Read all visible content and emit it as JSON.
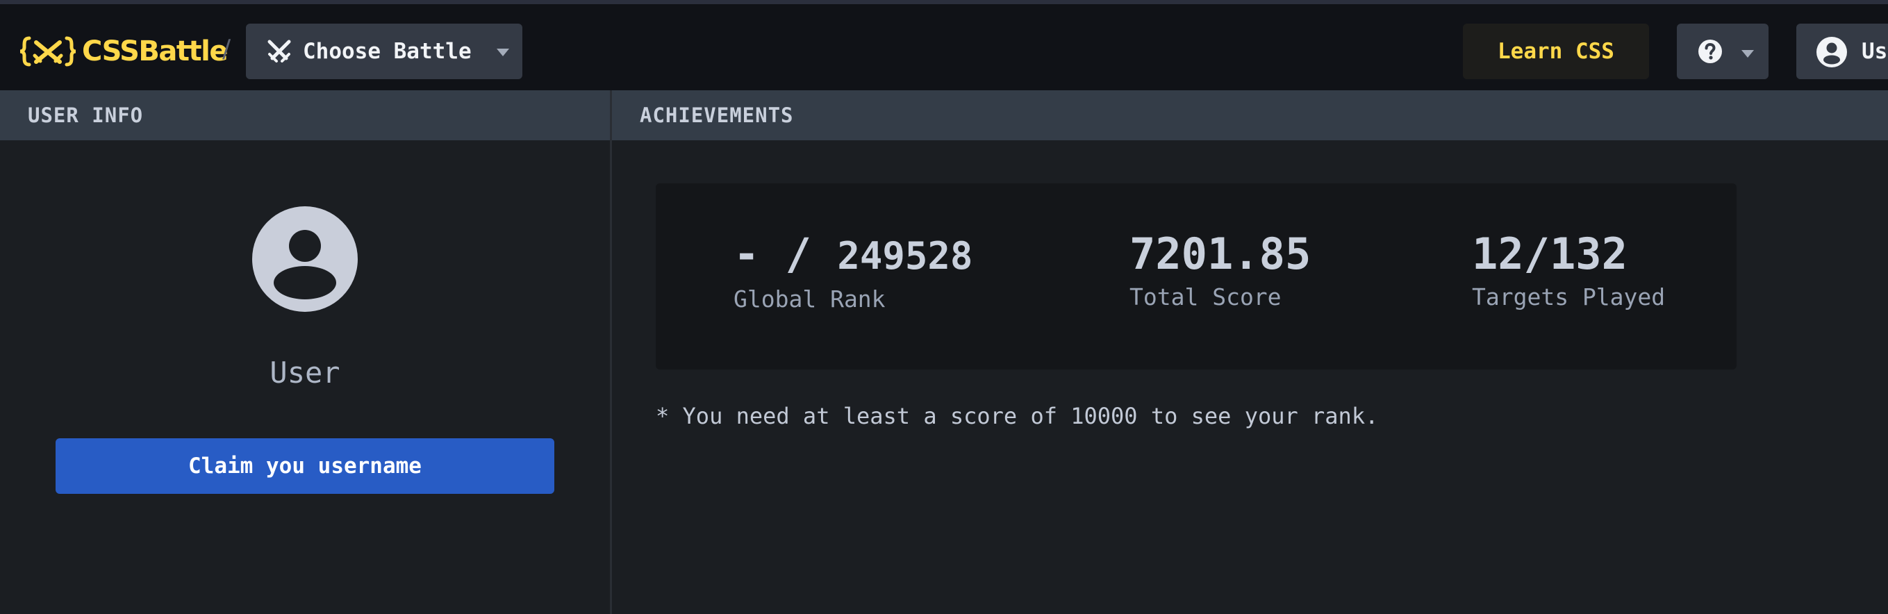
{
  "navbar": {
    "logo_text": "CSSBattle",
    "separator": "/",
    "choose_battle_label": "Choose Battle",
    "learn_css_label": "Learn CSS",
    "help_icon": "question-circle-icon",
    "user_label": "Us",
    "colors": {
      "brand": "#ffd84a",
      "navbar_bg": "#101217",
      "button_bg": "#343a45"
    }
  },
  "user_info": {
    "header": "USER INFO",
    "avatar_icon": "user-avatar-icon",
    "username": "User",
    "claim_button_label": "Claim you username",
    "claim_button_color": "#285cc5"
  },
  "achievements": {
    "header": "ACHIEVEMENTS",
    "stats": [
      {
        "value_prefix": "- / ",
        "value": "249528",
        "caption": "Global Rank"
      },
      {
        "value": "7201.85",
        "caption": "Total Score"
      },
      {
        "value": "12/132",
        "caption": "Targets Played"
      }
    ],
    "note": "* You need at least a score of 10000 to see your rank."
  }
}
